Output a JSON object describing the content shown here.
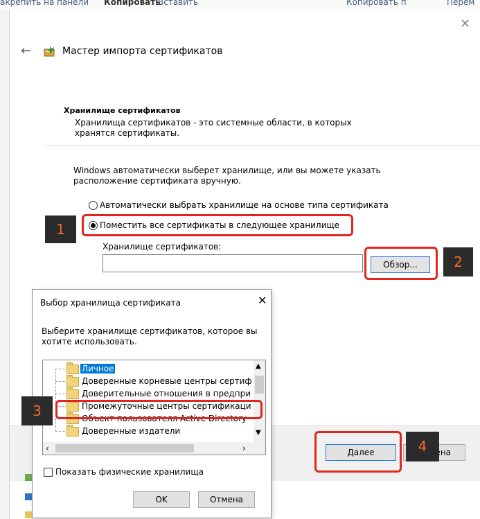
{
  "background": {
    "ribbon_text_1": "акрепить на панели",
    "ribbon_text_2": "Копировать",
    "ribbon_text_3": "Вставить",
    "ribbon_text_4": "Копировать п",
    "ribbon_text_5": "Перем"
  },
  "wizard": {
    "title": "Мастер импорта сертификатов",
    "section_title": "Хранилище сертификатов",
    "section_desc": "Хранилища сертификатов - это системные области, в которых хранятся сертификаты.",
    "intro": "Windows автоматически выберет хранилище, или вы можете указать расположение сертификата вручную.",
    "radio_auto_label": "Автоматически выбрать хранилище на основе типа сертификата",
    "radio_manual_label": "Поместить все сертификаты в следующее хранилище",
    "store_label": "Хранилище сертификатов:",
    "store_value": "",
    "browse_label": "Обзор...",
    "next_label": "Далее",
    "cancel_label": "Отмена"
  },
  "dialog": {
    "title": "Выбор хранилища сертификата",
    "description": "Выберите хранилище сертификатов, которое вы хотите использовать.",
    "tree_items": [
      "Личное",
      "Доверенные корневые центры сертиф",
      "Доверительные отношения в предпри",
      "Промежуточные центры сертификаци",
      "Объект пользователя Active Directory",
      "Доверенные издатели"
    ],
    "selected_index": 0,
    "show_physical_label": "Показать физические хранилища",
    "show_physical_checked": false,
    "ok_label": "OK",
    "cancel_label": "Отмена"
  },
  "annotations": {
    "badge_1": "1",
    "badge_2": "2",
    "badge_3": "3",
    "badge_4": "4",
    "highlight_color": "#e0261f",
    "badge_text_color": "#f46a2a"
  },
  "icons": {
    "close": "close-icon",
    "back": "back-arrow-icon",
    "wizard": "certificate-wizard-icon",
    "folder": "folder-icon"
  }
}
